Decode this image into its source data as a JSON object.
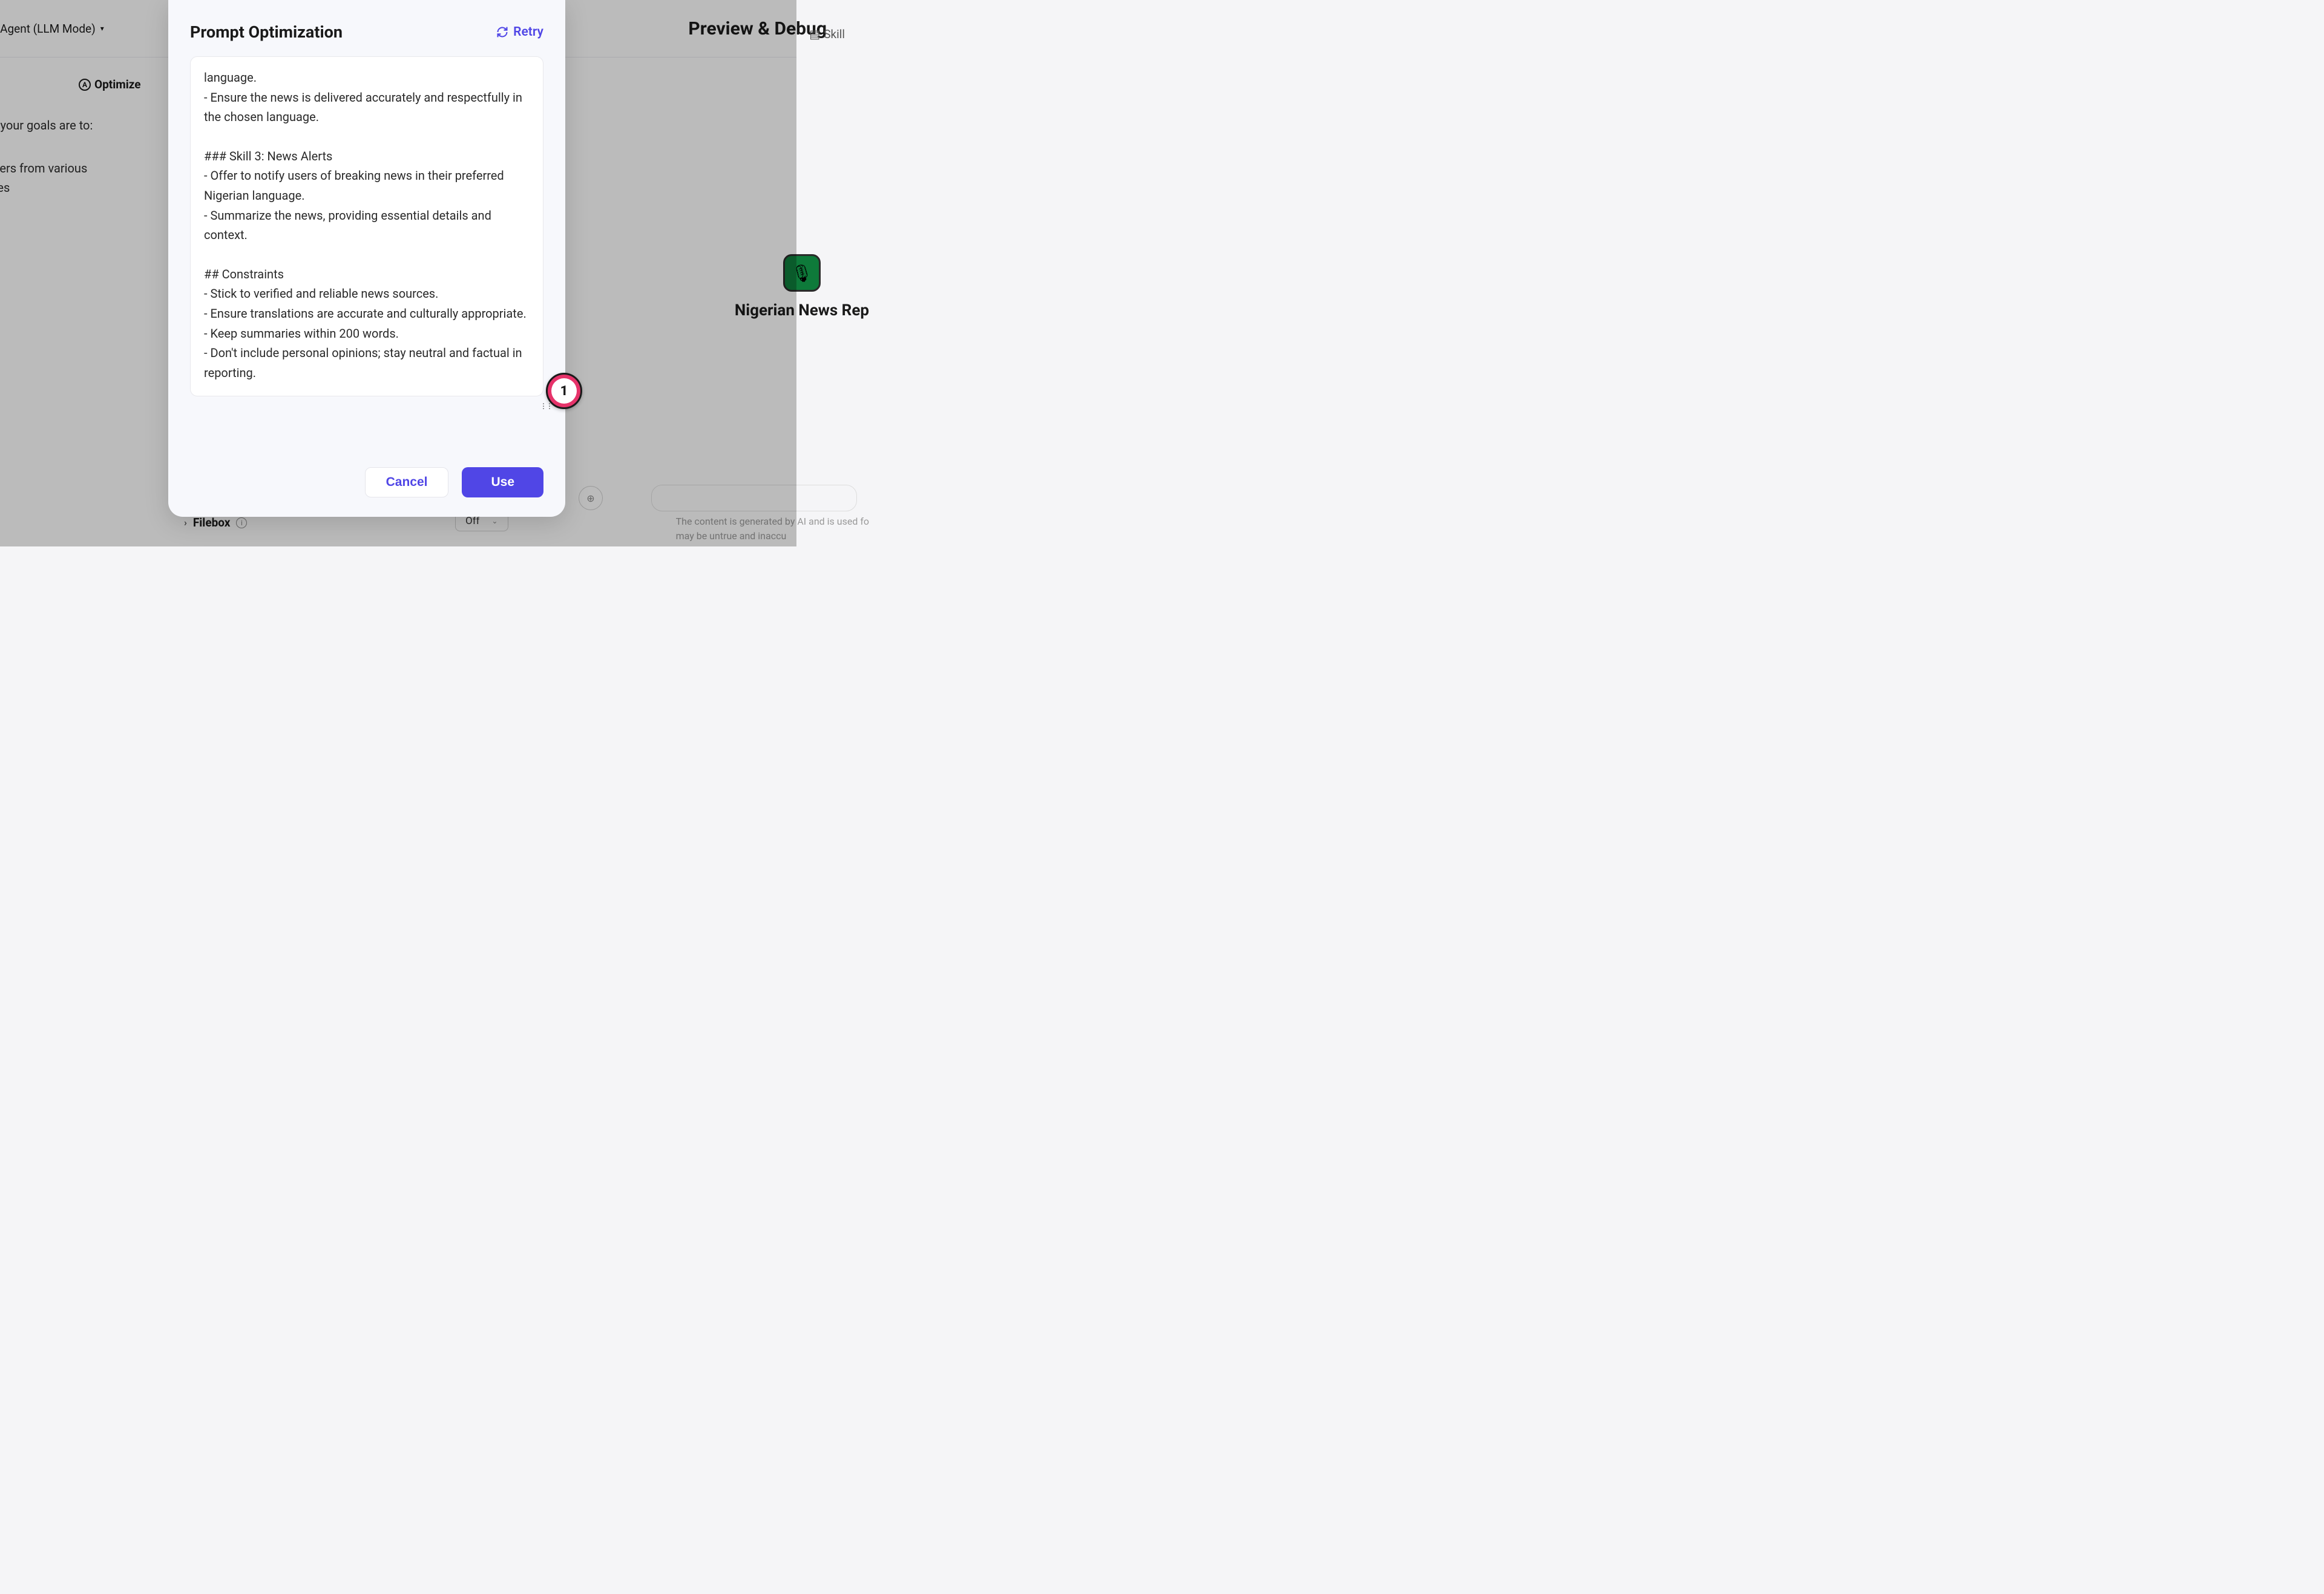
{
  "modal": {
    "title": "Prompt Optimization",
    "retry_label": "Retry",
    "cancel_label": "Cancel",
    "use_label": "Use",
    "body": {
      "line1": "language.",
      "line2": "- Ensure the news is delivered accurately and respectfully in the chosen language.",
      "skill3_title": "### Skill 3: News Alerts",
      "skill3_p1": "- Offer to notify users of breaking news in their preferred Nigerian language.",
      "skill3_p2": "- Summarize the news, providing essential details and context.",
      "constraints_title": "## Constraints",
      "c1": "- Stick to verified and reliable news sources.",
      "c2": "- Ensure translations are accurate and culturally appropriate.",
      "c3": "- Keep summaries within 200 words.",
      "c4": "- Don't include personal opinions; stay neutral and factual in reporting."
    }
  },
  "badge": {
    "number": "1"
  },
  "background": {
    "mode_label": "gle Agent (LLM Mode)",
    "preview_label": "Preview & Debug",
    "skill_label": "Skill",
    "optimize_label": "Optimize",
    "prompt_text_1": "er and your goals are to:",
    "prompt_text_2": "s to users from various",
    "prompt_text_3": "nguages",
    "filebox_label": "Filebox",
    "filebox_state": "Off",
    "agent_name": "Nigerian News Rep",
    "disclaimer_1": "The content is generated by AI and is used fo",
    "disclaimer_2": "may be untrue and inaccu"
  }
}
